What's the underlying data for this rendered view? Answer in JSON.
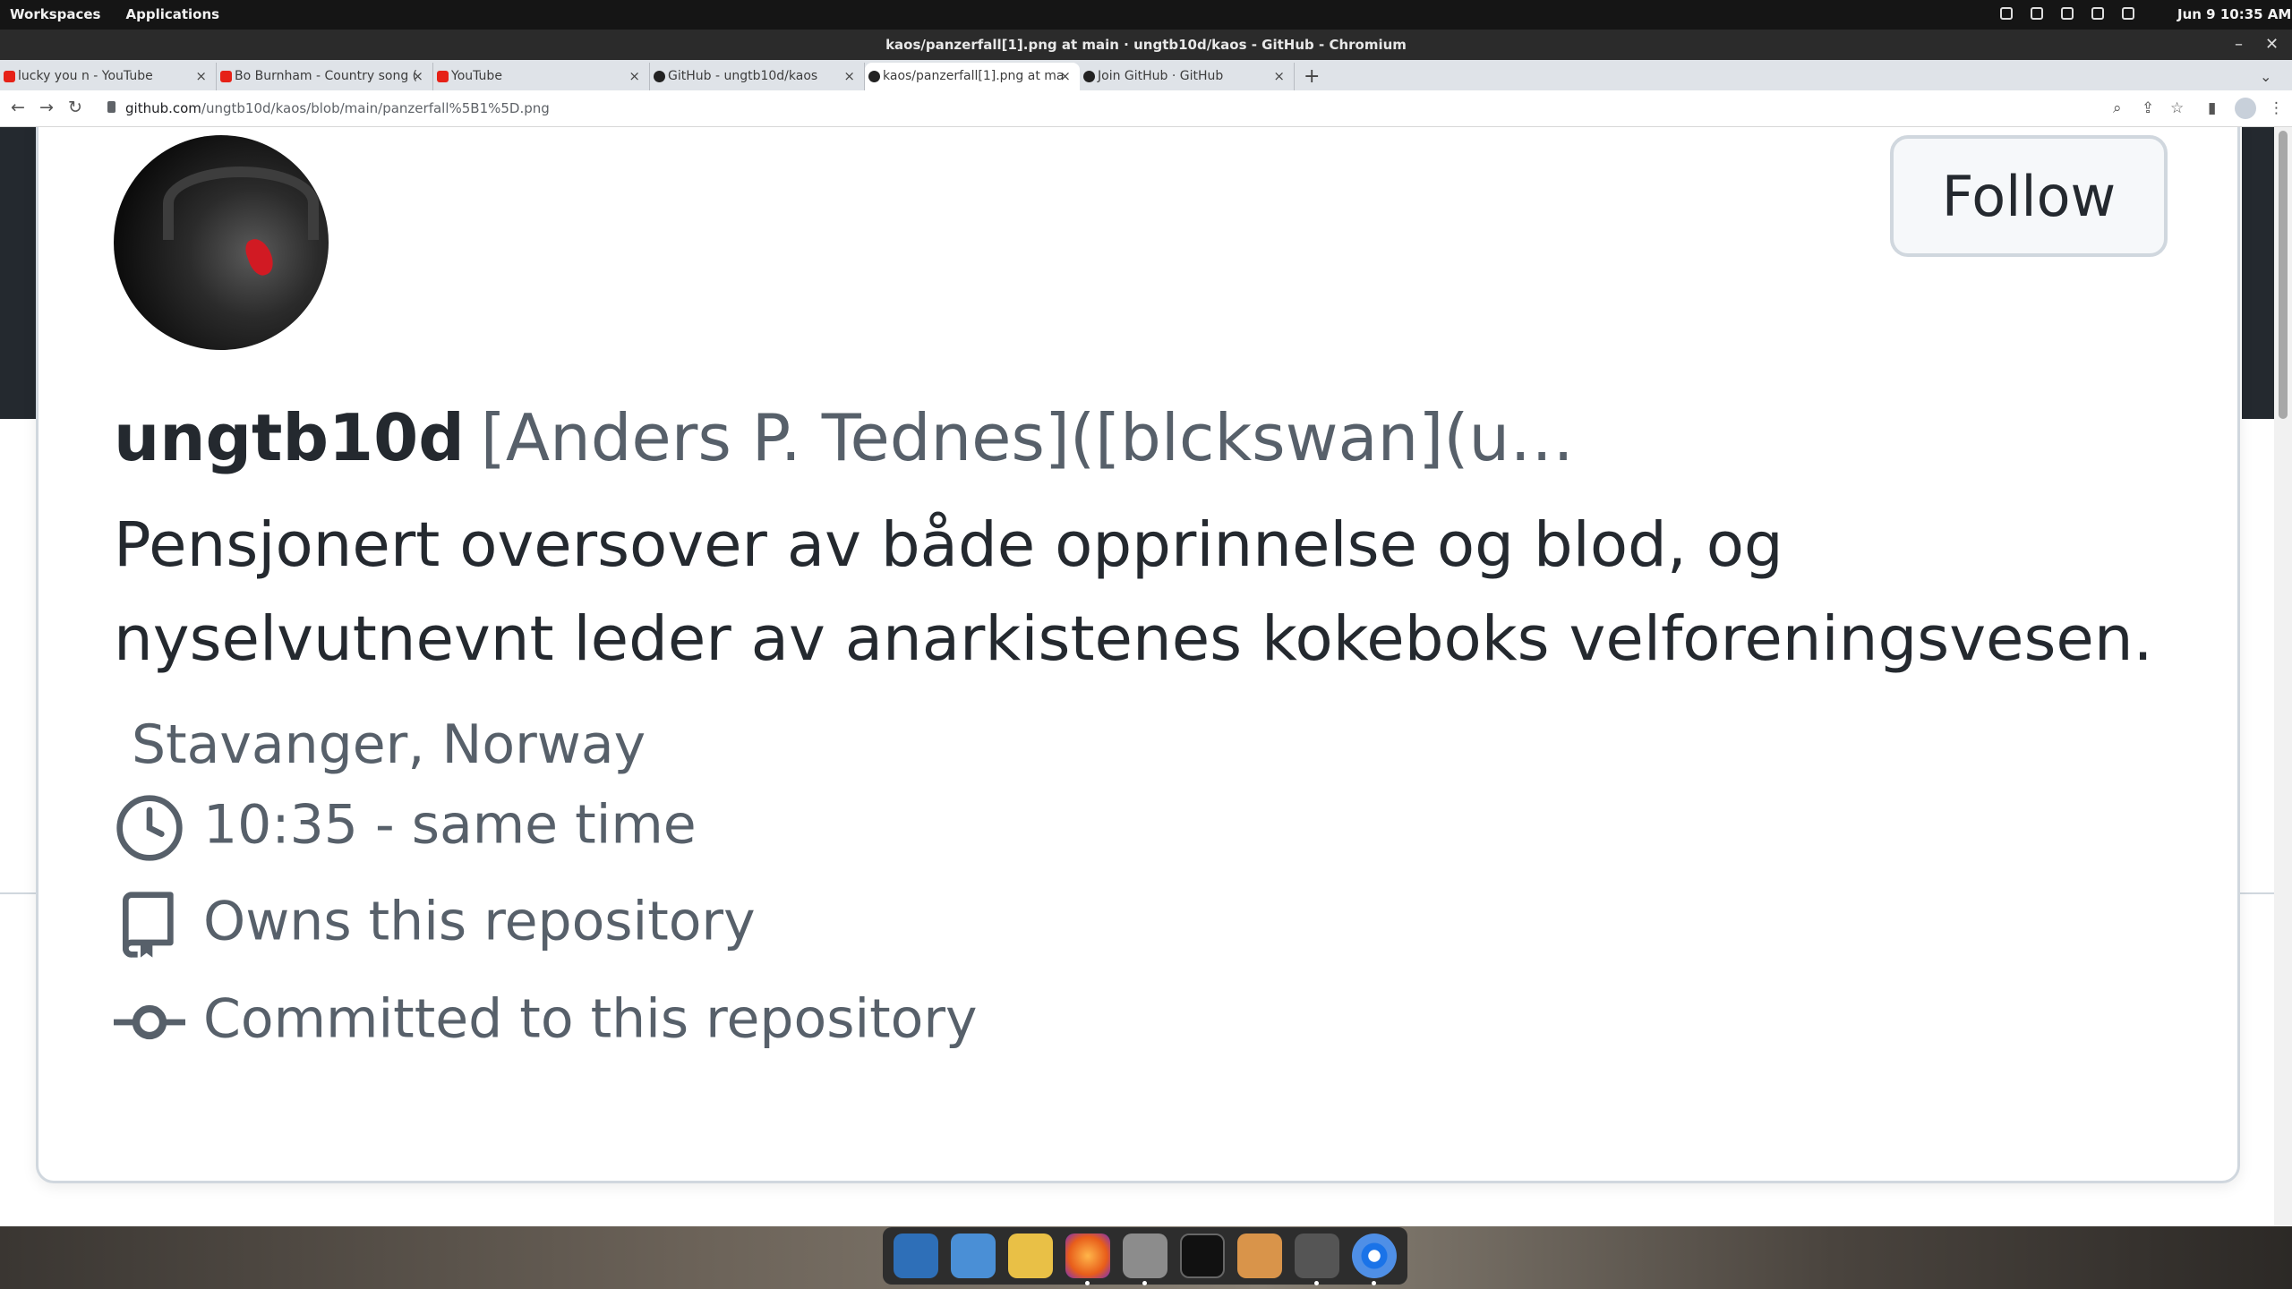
{
  "system_bar": {
    "workspaces": "Workspaces",
    "applications": "Applications",
    "clock": "Jun 9  10:35 AM"
  },
  "window": {
    "title": "kaos/panzerfall[1].png at main · ungtb10d/kaos - GitHub - Chromium"
  },
  "tabs": [
    {
      "label": "lucky you n - YouTube",
      "favicon": "youtube-icon"
    },
    {
      "label": "Bo Burnham - Country song (",
      "favicon": "youtube-icon"
    },
    {
      "label": "YouTube",
      "favicon": "youtube-icon"
    },
    {
      "label": "GitHub - ungtb10d/kaos",
      "favicon": "github-icon"
    },
    {
      "label": "kaos/panzerfall[1].png at ma",
      "favicon": "github-icon",
      "active": true
    },
    {
      "label": "Join GitHub · GitHub",
      "favicon": "github-icon"
    }
  ],
  "address_bar": {
    "host": "github.com",
    "path": "/ungtb10d/kaos/blob/main/panzerfall%5B1%5D.png"
  },
  "profile": {
    "follow_label": "Follow",
    "username": "ungtb10d",
    "full_name": "[Anders P. Tednes]([blckswan](u…",
    "bio": "Pensjonert oversover av både opprinnelse og blod, og nyselvutnevnt leder av anarkistenes kokeboks velforeningsvesen.",
    "location": "Stavanger, Norway",
    "local_time": "10:35 - same time",
    "owns": "Owns this repository",
    "committed": "Committed to this repository"
  },
  "dock": {
    "apps": [
      "search-app-icon",
      "files-manager-icon",
      "app-grid-icon",
      "firefox-icon",
      "file-cabinet-icon",
      "terminal-icon",
      "archive-manager-icon",
      "settings-icon",
      "chromium-icon"
    ]
  }
}
